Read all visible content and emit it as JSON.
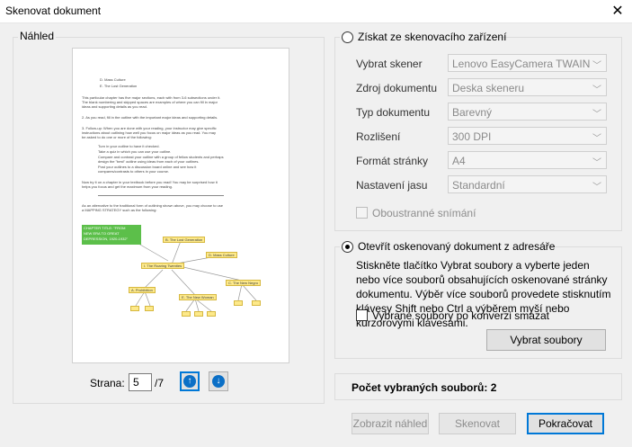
{
  "window": {
    "title": "Skenovat dokument"
  },
  "preview": {
    "group_label": "Náhled",
    "page_label": "Strana:",
    "page_value": "5",
    "page_total": "/7",
    "doc": {
      "toc": [
        "D. Mass Culture",
        "E. The Lost Generation"
      ],
      "para1": [
        "This particular chapter has five major sections, each with from 3-6 subsections under it.",
        "The blank numbering and skipped spaces are examples of where you can fill in major",
        "ideas and supporting details as you read."
      ],
      "para2": "2. As you read, fill in the outline with the important major ideas and supporting details.",
      "para3": [
        "3. Follow-up: When you are done with your reading, your instructor may give specific",
        "instructions about outlining how well you focus on major ideas as you read. You may",
        "be asked to do one or more of the following:"
      ],
      "bullets": [
        "Turn in your outline to have it checked.",
        "Take a quiz in which you can use your outline.",
        "Compare and contrast your outline with a group of fellow students and perhaps",
        "design the \"best\" outline using ideas from each of your outlines.",
        "Post your outlines to a discussion board online and see how it",
        "compares/contrasts to others in your course."
      ],
      "para4": [
        "Now try it on a chapter in your textbook before you read! You may be surprised how it",
        "helps you focus and get the maximum from your reading."
      ],
      "para5": [
        "As an alternative to the traditional form of outlining shown above, you may choose to use",
        "a MAPPING STRATEGY such as the following:"
      ],
      "map_title": [
        "CHAPTER TITLE: \"FROM",
        "NEW ERA TO GREAT",
        "DEPRESSION, 1920-1932\""
      ],
      "map_nodes": [
        "B. The Lost Generation",
        "D. Mass Culture",
        "I. The Roaring Twenties",
        "C. The New Negro",
        "A. Prohibition",
        "E. The New Woman"
      ]
    }
  },
  "scanner": {
    "radio_label": "Získat ze skenovacího zařízení",
    "fields": [
      {
        "label": "Vybrat skener",
        "value": "Lenovo EasyCamera TWAIN"
      },
      {
        "label": "Zdroj dokumentu",
        "value": "Deska skeneru"
      },
      {
        "label": "Typ dokumentu",
        "value": "Barevný"
      },
      {
        "label": "Rozlišení",
        "value": "300 DPI"
      },
      {
        "label": "Formát stránky",
        "value": "A4"
      },
      {
        "label": "Nastavení jasu",
        "value": "Standardní"
      }
    ],
    "duplex_label": "Oboustranné snímání"
  },
  "folder": {
    "radio_label": "Otevřít oskenovaný dokument z adresáře",
    "description": "Stiskněte tlačítko Vybrat soubory a vyberte jeden nebo více souborů obsahujících oskenované stránky dokumentu. Výběr více souborů provedete stisknutím klávesy Shift nebo Ctrl a výběrem myší nebo kurzorovými klávesami.",
    "delete_label": "Vybrané soubory po konverzi smazat",
    "select_button": "Vybrat soubory"
  },
  "status": {
    "count_text": "Počet vybraných souborů: 2"
  },
  "buttons": {
    "preview": "Zobrazit náhled",
    "scan": "Skenovat",
    "continue": "Pokračovat"
  }
}
